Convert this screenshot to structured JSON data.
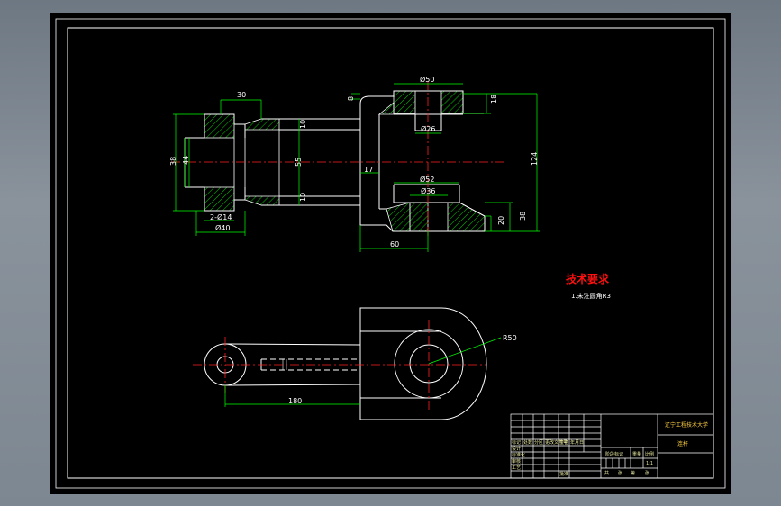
{
  "colors": {
    "workspace": "#8a939c",
    "sheet": "#000000",
    "outline": "#ffffff",
    "center_line": "#ff2020",
    "dimension": "#00ff00",
    "hatch": "#00ff00",
    "title_text": "#ff1010"
  },
  "front_view": {
    "dims": {
      "d30_top": "30",
      "d8": "8",
      "d050": "Ø50",
      "d18": "18",
      "d026": "Ø26",
      "d10_top": "10",
      "d38": "38",
      "d44": "44",
      "d55": "55",
      "d17": "17",
      "d124": "124",
      "d052": "Ø52",
      "d036": "Ø36",
      "d10_bottom": "10",
      "d2x014": "2-Ø14",
      "d20": "20",
      "d38_right": "38",
      "d040": "Ø40",
      "d60": "60"
    }
  },
  "tech_req": {
    "title": "技术要求",
    "line1": "1.未注圆角R3"
  },
  "top_view": {
    "r50": "R50",
    "len180": "180"
  },
  "title_block": {
    "school": "辽宁工程技术大学",
    "drawing_name": "连杆",
    "scale": "1:1",
    "row_labels": [
      "标记",
      "处数",
      "分区",
      "更改文件号",
      "签名",
      "年月日"
    ],
    "lower_labels": [
      "设计",
      "审核",
      "工艺",
      "批准"
    ],
    "mid_labels": [
      "标准化",
      "阶段标记",
      "重量",
      "比例"
    ],
    "sheet_labels": [
      "共",
      "张",
      "第",
      "张"
    ]
  }
}
